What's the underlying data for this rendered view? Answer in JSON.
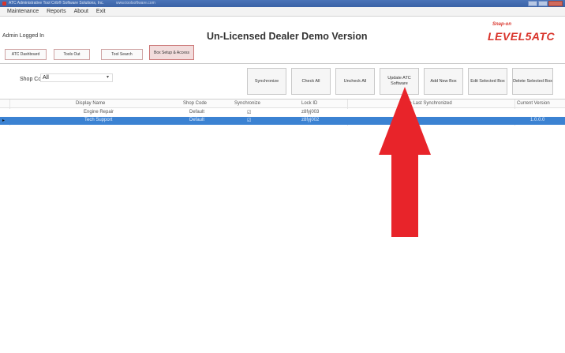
{
  "window": {
    "title": "ATC Administrative Tool Crib® Software Solutions, Inc.",
    "title_link": "www.toolsoftware.com"
  },
  "menu": [
    "Maintenance",
    "Reports",
    "About",
    "Exit"
  ],
  "header": {
    "admin": "Admin Logged In",
    "title": "Un-Licensed Dealer Demo Version",
    "logo_tag": "Snap-on",
    "logo_main": "LEVEL5ATC"
  },
  "tabs": [
    {
      "label": "ATC Dashboard"
    },
    {
      "label": "Tools Out"
    },
    {
      "label": "Tool Search"
    },
    {
      "label": "Box Setup & Access",
      "active": true
    }
  ],
  "shop_code": {
    "label": "Shop Code",
    "value": "All"
  },
  "buttons": {
    "synchronize": "Synchronize",
    "check_all": "Check All",
    "uncheck_all": "Uncheck All",
    "update_atc": "Update ATC Software",
    "add_new_box": "Add New Box",
    "edit_selected_box": "Edit Selected Box",
    "delete_selected_box": "Delete Selected Box"
  },
  "grid": {
    "columns": [
      "Display Name",
      "Shop Code",
      "Synchronize",
      "Lock ID",
      "Date Last Synchronized",
      "Current Version"
    ],
    "rows": [
      {
        "display_name": "Engine Repair",
        "shop_code": "Default",
        "synchronize": "☑",
        "lock_id": "z8fyj003",
        "date": "",
        "version": ""
      },
      {
        "display_name": "Tech Support",
        "shop_code": "Default",
        "synchronize": "☑",
        "lock_id": "z8fyj002",
        "date": "",
        "version": "1.0.0.0",
        "selected": true
      }
    ]
  },
  "colors": {
    "accent_red": "#e8242a",
    "selection_blue": "#3b82d2",
    "titlebar_blue": "#4a74b8"
  }
}
